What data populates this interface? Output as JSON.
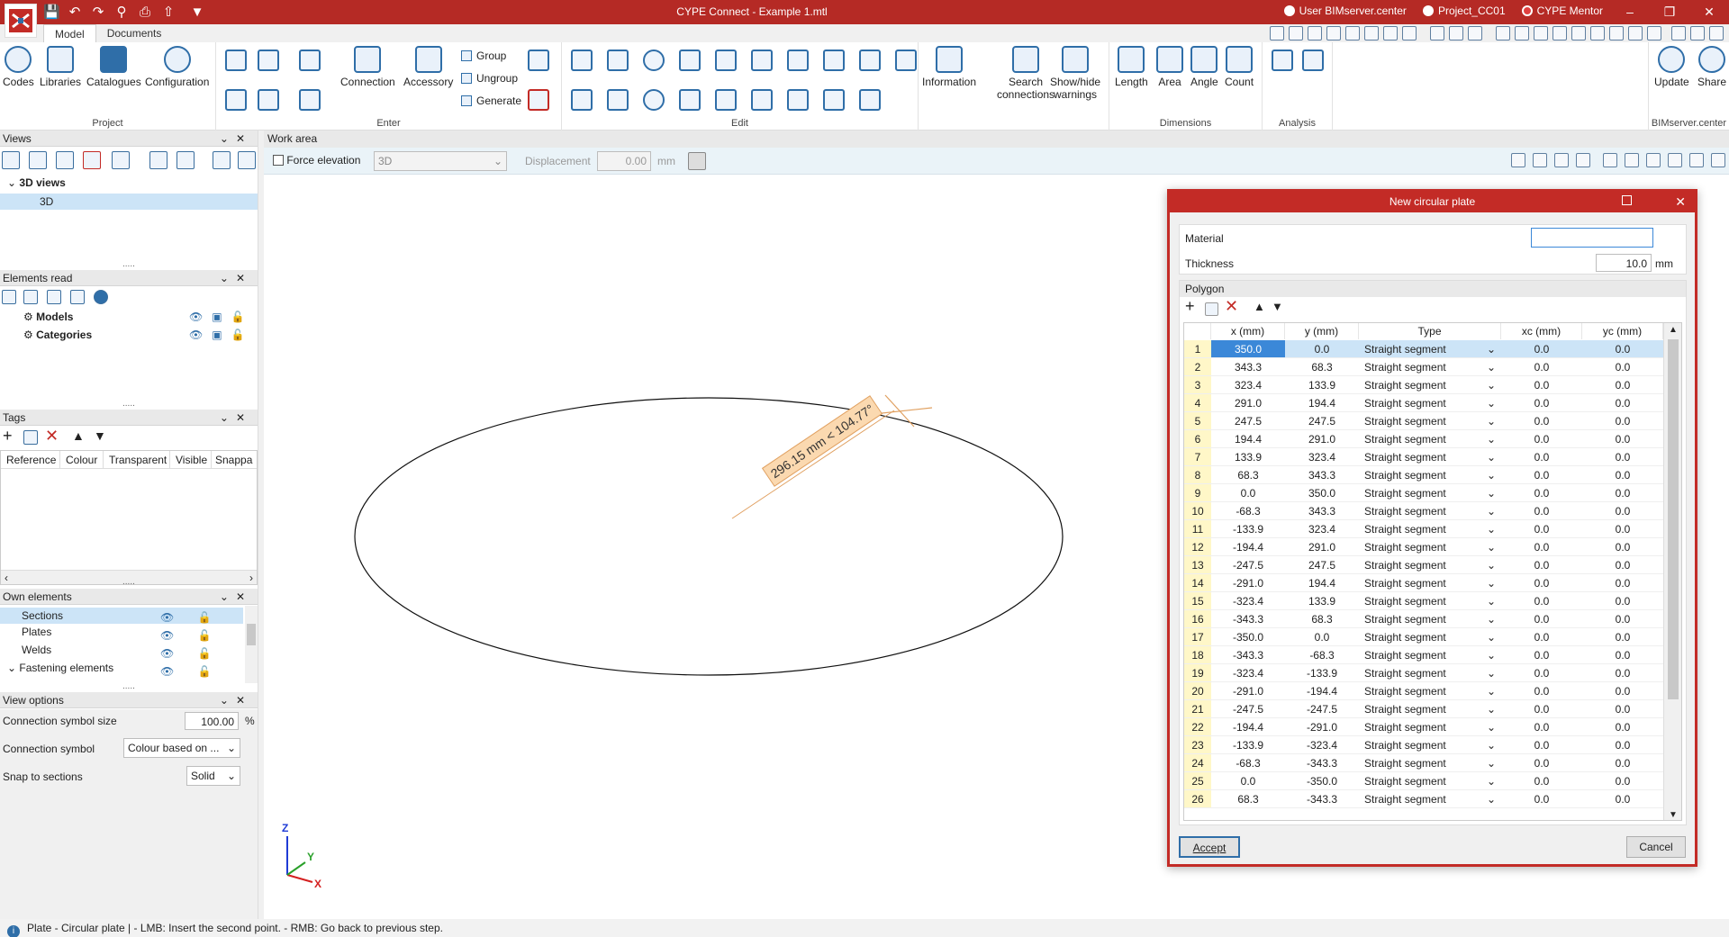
{
  "window": {
    "title": "CYPE Connect - Example 1.mtl",
    "user": "User BIMserver.center",
    "project": "Project_CC01",
    "mentor": "CYPE Mentor"
  },
  "tabs": [
    "Model",
    "Documents"
  ],
  "ribbon": {
    "project": {
      "label": "Project",
      "codes": "Codes",
      "libraries": "Libraries",
      "catalogues": "Catalogues",
      "configuration": "Configuration"
    },
    "enter": {
      "label": "Enter",
      "connection": "Connection",
      "accessory": "Accessory",
      "group": "Group",
      "ungroup": "Ungroup",
      "generate": "Generate"
    },
    "edit": {
      "label": "Edit"
    },
    "info": {
      "information": "Information",
      "search": "Search",
      "search2": "connections",
      "showhide": "Show/hide",
      "showhide2": "warnings"
    },
    "dimensions": {
      "label": "Dimensions",
      "length": "Length",
      "area": "Area",
      "angle": "Angle",
      "count": "Count"
    },
    "analysis": {
      "label": "Analysis"
    },
    "bim": {
      "label": "BIMserver.center",
      "update": "Update",
      "share": "Share"
    }
  },
  "views": {
    "title": "Views",
    "group": "3D views",
    "item": "3D"
  },
  "elements_read": {
    "title": "Elements read",
    "items": [
      "Models",
      "Categories"
    ]
  },
  "tags": {
    "title": "Tags",
    "columns": [
      "Reference",
      "Colour",
      "Transparent",
      "Visible",
      "Snappa"
    ]
  },
  "own_elements": {
    "title": "Own elements",
    "items": [
      "Sections",
      "Plates",
      "Welds",
      "Fastening elements"
    ]
  },
  "view_options": {
    "title": "View options",
    "size_label": "Connection symbol size",
    "size_value": "100.00",
    "size_unit": "%",
    "symbol_label": "Connection symbol",
    "symbol_value": "Colour based on ...",
    "snap_label": "Snap to sections",
    "snap_value": "Solid"
  },
  "work_area": {
    "title": "Work area",
    "force_elevation": "Force elevation",
    "plane": "3D",
    "displacement_label": "Displacement",
    "displacement_value": "0.00",
    "displacement_unit": "mm",
    "dimension_label": "296.15 mm < 104.77°"
  },
  "axes": {
    "z": "Z",
    "y": "Y",
    "x": "X"
  },
  "dialog": {
    "title": "New circular plate",
    "material_label": "Material",
    "material_value": "",
    "thickness_label": "Thickness",
    "thickness_value": "10.0",
    "thickness_unit": "mm",
    "polygon_label": "Polygon",
    "columns": [
      "x (mm)",
      "y (mm)",
      "Type",
      "xc (mm)",
      "yc (mm)"
    ],
    "rows": [
      [
        "1",
        "350.0",
        "0.0",
        "Straight segment",
        "0.0",
        "0.0"
      ],
      [
        "2",
        "343.3",
        "68.3",
        "Straight segment",
        "0.0",
        "0.0"
      ],
      [
        "3",
        "323.4",
        "133.9",
        "Straight segment",
        "0.0",
        "0.0"
      ],
      [
        "4",
        "291.0",
        "194.4",
        "Straight segment",
        "0.0",
        "0.0"
      ],
      [
        "5",
        "247.5",
        "247.5",
        "Straight segment",
        "0.0",
        "0.0"
      ],
      [
        "6",
        "194.4",
        "291.0",
        "Straight segment",
        "0.0",
        "0.0"
      ],
      [
        "7",
        "133.9",
        "323.4",
        "Straight segment",
        "0.0",
        "0.0"
      ],
      [
        "8",
        "68.3",
        "343.3",
        "Straight segment",
        "0.0",
        "0.0"
      ],
      [
        "9",
        "0.0",
        "350.0",
        "Straight segment",
        "0.0",
        "0.0"
      ],
      [
        "10",
        "-68.3",
        "343.3",
        "Straight segment",
        "0.0",
        "0.0"
      ],
      [
        "11",
        "-133.9",
        "323.4",
        "Straight segment",
        "0.0",
        "0.0"
      ],
      [
        "12",
        "-194.4",
        "291.0",
        "Straight segment",
        "0.0",
        "0.0"
      ],
      [
        "13",
        "-247.5",
        "247.5",
        "Straight segment",
        "0.0",
        "0.0"
      ],
      [
        "14",
        "-291.0",
        "194.4",
        "Straight segment",
        "0.0",
        "0.0"
      ],
      [
        "15",
        "-323.4",
        "133.9",
        "Straight segment",
        "0.0",
        "0.0"
      ],
      [
        "16",
        "-343.3",
        "68.3",
        "Straight segment",
        "0.0",
        "0.0"
      ],
      [
        "17",
        "-350.0",
        "0.0",
        "Straight segment",
        "0.0",
        "0.0"
      ],
      [
        "18",
        "-343.3",
        "-68.3",
        "Straight segment",
        "0.0",
        "0.0"
      ],
      [
        "19",
        "-323.4",
        "-133.9",
        "Straight segment",
        "0.0",
        "0.0"
      ],
      [
        "20",
        "-291.0",
        "-194.4",
        "Straight segment",
        "0.0",
        "0.0"
      ],
      [
        "21",
        "-247.5",
        "-247.5",
        "Straight segment",
        "0.0",
        "0.0"
      ],
      [
        "22",
        "-194.4",
        "-291.0",
        "Straight segment",
        "0.0",
        "0.0"
      ],
      [
        "23",
        "-133.9",
        "-323.4",
        "Straight segment",
        "0.0",
        "0.0"
      ],
      [
        "24",
        "-68.3",
        "-343.3",
        "Straight segment",
        "0.0",
        "0.0"
      ],
      [
        "25",
        "0.0",
        "-350.0",
        "Straight segment",
        "0.0",
        "0.0"
      ],
      [
        "26",
        "68.3",
        "-343.3",
        "Straight segment",
        "0.0",
        "0.0"
      ]
    ],
    "accept": "Accept",
    "cancel": "Cancel"
  },
  "status": {
    "text": "Plate - Circular plate  |  - LMB: Insert the second point. - RMB: Go back to previous step."
  },
  "colors": {
    "brand": "#b52a25",
    "accent": "#2f6ea8",
    "selection": "#cce4f7"
  }
}
